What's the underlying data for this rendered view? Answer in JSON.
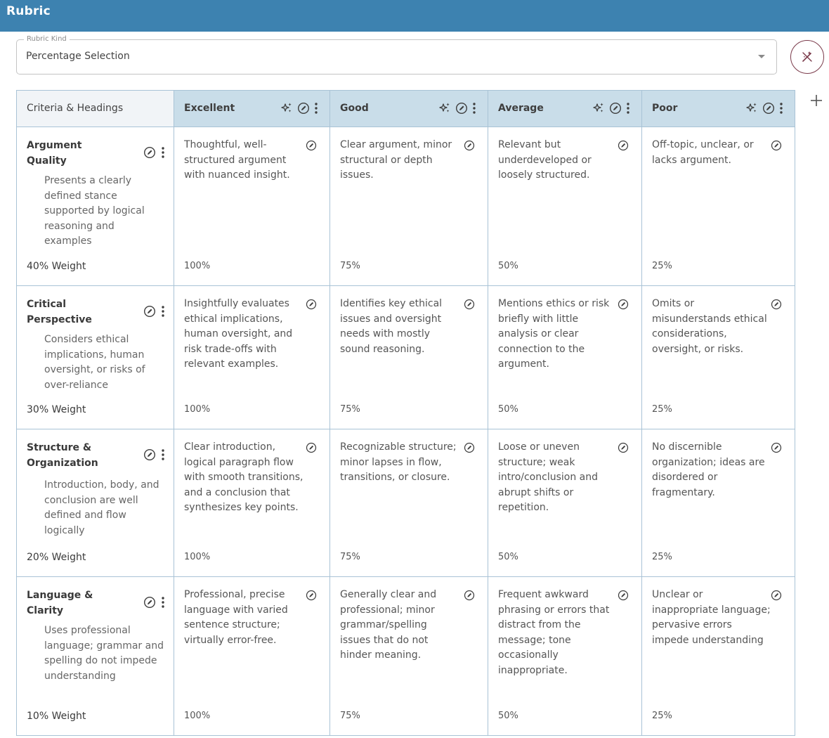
{
  "header": {
    "title": "Rubric"
  },
  "rubric_kind": {
    "label": "Rubric Kind",
    "value": "Percentage Selection"
  },
  "table": {
    "criteria_header": "Criteria & Headings",
    "levels": [
      {
        "name": "Excellent"
      },
      {
        "name": "Good"
      },
      {
        "name": "Average"
      },
      {
        "name": "Poor"
      }
    ],
    "rows": [
      {
        "name": "Argument Quality",
        "description": "Presents a clearly defined stance supported by logical reasoning and examples",
        "weight": "40% Weight",
        "cells": [
          {
            "text": "Thoughtful, well-structured argument with nuanced insight.",
            "pct": "100%"
          },
          {
            "text": "Clear argument, minor structural or depth issues.",
            "pct": "75%"
          },
          {
            "text": "Relevant but underdeveloped or loosely structured.",
            "pct": "50%"
          },
          {
            "text": "Off-topic, unclear, or lacks argument.",
            "pct": "25%"
          }
        ]
      },
      {
        "name": "Critical Perspective",
        "description": "Considers ethical implications, human oversight, or risks of over-reliance",
        "weight": "30% Weight",
        "cells": [
          {
            "text": "Insightfully evaluates ethical implications, human oversight, and risk trade-offs with relevant examples.",
            "pct": "100%"
          },
          {
            "text": "Identifies key ethical issues and oversight needs with mostly sound reasoning.",
            "pct": "75%"
          },
          {
            "text": "Mentions ethics or risk briefly with little analysis or clear connection to the argument.",
            "pct": "50%"
          },
          {
            "text": "Omits or misunderstands ethical considerations, oversight, or risks.",
            "pct": "25%"
          }
        ]
      },
      {
        "name": "Structure & Organization",
        "description": "Introduction, body, and conclusion are well defined and flow logically",
        "weight": "20% Weight",
        "cells": [
          {
            "text": "Clear introduction, logical paragraph flow with smooth transitions, and a conclusion that synthesizes key points.",
            "pct": "100%"
          },
          {
            "text": "Recognizable structure; minor lapses in flow, transitions, or closure.",
            "pct": "75%"
          },
          {
            "text": "Loose or uneven structure; weak intro/conclusion and abrupt shifts or repetition.",
            "pct": "50%"
          },
          {
            "text": "No discernible organization; ideas are disordered or fragmentary.",
            "pct": "25%"
          }
        ]
      },
      {
        "name": "Language & Clarity",
        "description": "Uses professional language; grammar and spelling do not impede understanding",
        "weight": "10% Weight",
        "cells": [
          {
            "text": "Professional, precise language with varied sentence structure; virtually error-free.",
            "pct": "100%"
          },
          {
            "text": "Generally clear and professional; minor grammar/spelling issues that do not hinder meaning.",
            "pct": "75%"
          },
          {
            "text": "Frequent awkward phrasing or errors that distract from the message; tone occasionally inappropriate.",
            "pct": "50%"
          },
          {
            "text": "Unclear or inappropriate language; pervasive errors impede understanding",
            "pct": "25%"
          }
        ]
      }
    ]
  },
  "icons": {
    "edit": "compass-edit-icon",
    "more": "more-vertical-icon",
    "sparkle": "sparkle-icon",
    "magic": "magic-wand-icon",
    "add": "plus-icon"
  }
}
